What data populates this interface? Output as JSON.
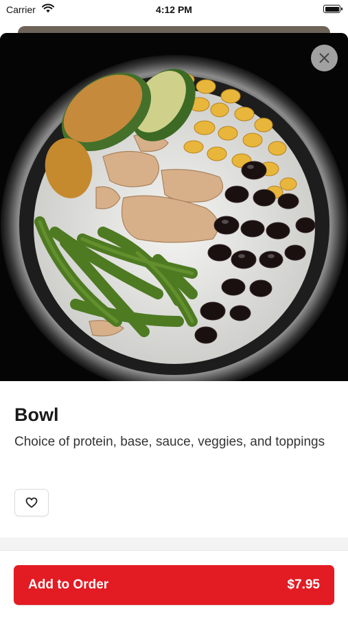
{
  "status_bar": {
    "carrier": "Carrier",
    "time": "4:12 PM",
    "icons": [
      "wifi-icon",
      "battery-icon"
    ]
  },
  "hero": {
    "image": "bowl-photo",
    "close_icon": "close-icon"
  },
  "item": {
    "name": "Bowl",
    "description": "Choice of protein, base, sauce, veggies, and toppings",
    "favorite_icon": "heart-icon"
  },
  "footer": {
    "add_label": "Add to Order",
    "price": "$7.95"
  },
  "colors": {
    "accent": "#e31b23",
    "text": "#1a1a1a",
    "background": "#ffffff"
  }
}
